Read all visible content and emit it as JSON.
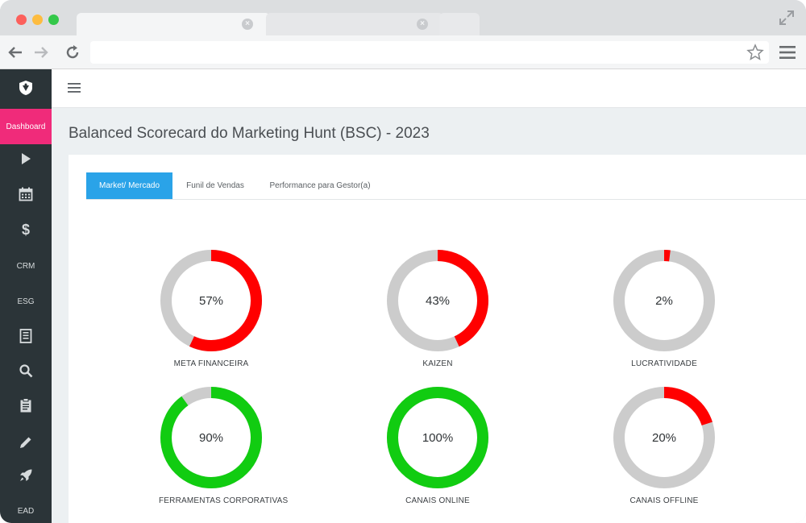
{
  "browser": {
    "url": ""
  },
  "app": {
    "sidebar": {
      "items": [
        {
          "type": "logo",
          "icon": "shield-logo-icon"
        },
        {
          "type": "text",
          "label": "Dashboard",
          "active": true
        },
        {
          "type": "icon",
          "icon": "play-icon"
        },
        {
          "type": "icon",
          "icon": "calendar-icon"
        },
        {
          "type": "icon",
          "icon": "dollar-icon"
        },
        {
          "type": "text",
          "label": "CRM"
        },
        {
          "type": "text",
          "label": "ESG"
        },
        {
          "type": "icon",
          "icon": "book-icon"
        },
        {
          "type": "icon",
          "icon": "search-icon"
        },
        {
          "type": "icon",
          "icon": "clipboard-icon"
        },
        {
          "type": "icon",
          "icon": "pencil-icon"
        },
        {
          "type": "icon",
          "icon": "rocket-icon"
        },
        {
          "type": "text",
          "label": "EAD"
        }
      ]
    },
    "page_title": "Balanced Scorecard do Marketing Hunt (BSC) - 2023",
    "tabs": [
      {
        "label": "Market/ Mercado",
        "active": true
      },
      {
        "label": "Funil de Vendas",
        "active": false
      },
      {
        "label": "Performance para Gestor(a)",
        "active": false
      }
    ],
    "gauges": [
      {
        "label": "META FINANCEIRA",
        "value_text": "57%",
        "value": 57,
        "color": "#ff0000"
      },
      {
        "label": "KAIZEN",
        "value_text": "43%",
        "value": 43,
        "color": "#ff0000"
      },
      {
        "label": "LUCRATIVIDADE",
        "value_text": "2%",
        "value": 2,
        "color": "#ff0000"
      },
      {
        "label": "FERRAMENTAS CORPORATIVAS",
        "value_text": "90%",
        "value": 90,
        "color": "#11cc11"
      },
      {
        "label": "CANAIS ONLINE",
        "value_text": "100%",
        "value": 100,
        "color": "#11cc11"
      },
      {
        "label": "CANAIS OFFLINE",
        "value_text": "20%",
        "value": 20,
        "color": "#ff0000"
      }
    ],
    "colors": {
      "sidebar_bg": "#2b3438",
      "active_accent": "#f02b7a",
      "tab_active": "#2aa3e8",
      "gauge_track": "#cccccc"
    }
  }
}
